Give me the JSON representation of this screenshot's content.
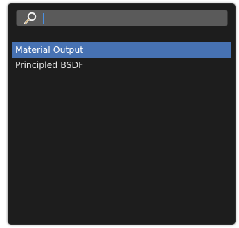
{
  "search": {
    "value": "",
    "placeholder": "",
    "icon": "search-icon"
  },
  "results": {
    "items": [
      {
        "label": "Material Output",
        "selected": true
      },
      {
        "label": "Principled BSDF",
        "selected": false
      }
    ]
  },
  "colors": {
    "panel_background": "#1d1d1d",
    "search_field": "#5a5a5a",
    "selection_highlight": "#4772b3",
    "text": "#e6e6e6",
    "cursor": "#4a90e2"
  }
}
